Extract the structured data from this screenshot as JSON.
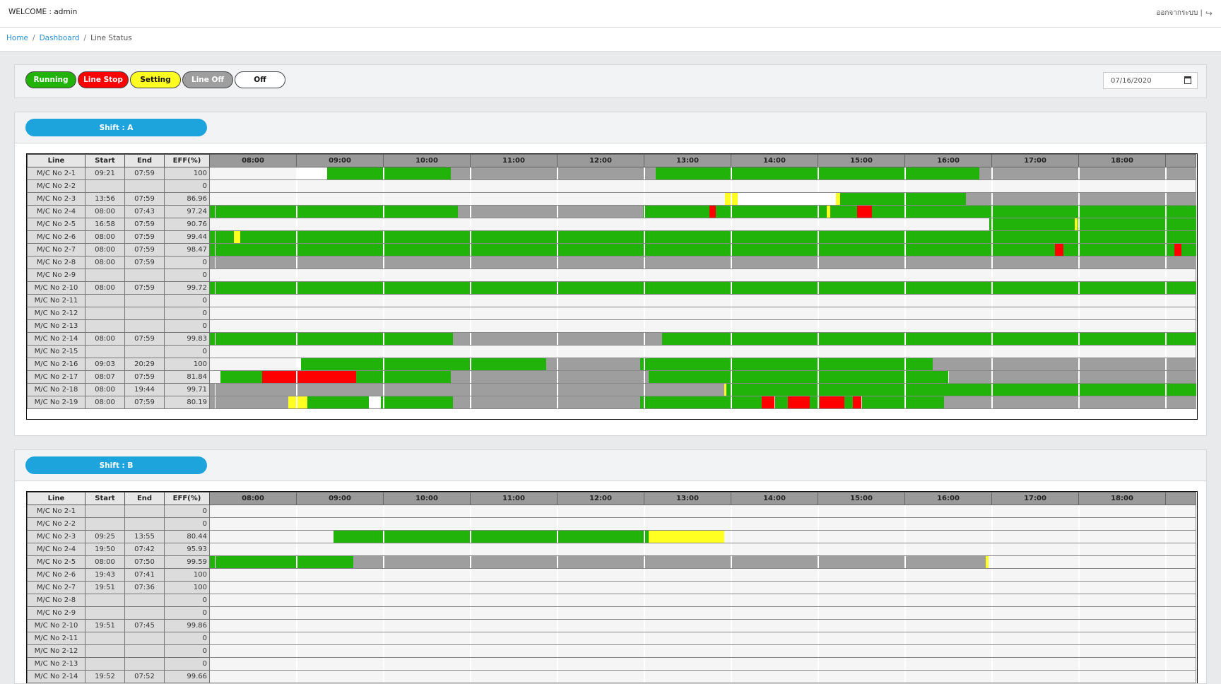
{
  "header": {
    "welcome": "WELCOME : admin",
    "logout_label": "ออกจากระบบ |",
    "logout_icon": "logout-icon"
  },
  "breadcrumb": {
    "home": "Home",
    "dashboard": "Dashboard",
    "current": "Line Status",
    "sep": "/"
  },
  "legend": [
    {
      "label": "Running",
      "color": "#22b30a",
      "text_color": "#ffffff"
    },
    {
      "label": "Line Stop",
      "color": "#ff0000",
      "text_color": "#ffffff"
    },
    {
      "label": "Setting",
      "color": "#ffff22",
      "text_color": "#111111"
    },
    {
      "label": "Line Off",
      "color": "#9e9e9e",
      "text_color": "#ffffff"
    },
    {
      "label": "Off",
      "color": "#ffffff",
      "text_color": "#111111"
    }
  ],
  "date": {
    "value": "07/16/2020",
    "icon": "calendar-icon"
  },
  "columns": {
    "line": "Line",
    "start": "Start",
    "end": "End",
    "eff": "EFF(%)"
  },
  "hours": [
    "08:00",
    "09:00",
    "10:00",
    "11:00",
    "12:00",
    "13:00",
    "14:00",
    "15:00",
    "16:00",
    "17:00",
    "18:00"
  ],
  "status_colors": {
    "R": "#22b30a",
    "S": "#ff0000",
    "T": "#ffff22",
    "G": "#9e9e9e",
    "W": "#ffffff"
  },
  "shifts": [
    {
      "name": "Shift : A",
      "rows": [
        {
          "line": "M/C No 2-1",
          "start": "09:21",
          "end": "07:59",
          "eff": "100",
          "segs": [
            [
              "W",
              1.0,
              1.35
            ],
            [
              "R",
              1.35,
              2.77
            ],
            [
              "G",
              2.77,
              5.13
            ],
            [
              "R",
              5.13,
              8.85
            ],
            [
              "G",
              8.85,
              11.35
            ]
          ]
        },
        {
          "line": "M/C No 2-2",
          "start": "",
          "end": "",
          "eff": "0",
          "segs": []
        },
        {
          "line": "M/C No 2-3",
          "start": "13:56",
          "end": "07:59",
          "eff": "86.96",
          "segs": [
            [
              "T",
              5.93,
              6.07
            ],
            [
              "W",
              6.07,
              7.2
            ],
            [
              "T",
              7.2,
              7.25
            ],
            [
              "R",
              7.25,
              8.7
            ],
            [
              "G",
              8.7,
              11.35
            ]
          ]
        },
        {
          "line": "M/C No 2-4",
          "start": "08:00",
          "end": "07:43",
          "eff": "97.24",
          "segs": [
            [
              "R",
              0,
              2.85
            ],
            [
              "G",
              2.85,
              4.98
            ],
            [
              "R",
              4.98,
              5.75
            ],
            [
              "S",
              5.75,
              5.82
            ],
            [
              "R",
              5.82,
              6.98
            ],
            [
              "T",
              6.98,
              7.0
            ],
            [
              "R",
              6.96,
              7.1
            ],
            [
              "T",
              7.1,
              7.14
            ],
            [
              "R",
              7.14,
              7.45
            ],
            [
              "S",
              7.45,
              7.62
            ],
            [
              "R",
              7.62,
              11.35
            ]
          ]
        },
        {
          "line": "M/C No 2-5",
          "start": "16:58",
          "end": "07:59",
          "eff": "90.76",
          "segs": [
            [
              "R",
              8.97,
              9.95
            ],
            [
              "T",
              9.95,
              9.98
            ],
            [
              "R",
              9.98,
              11.35
            ]
          ]
        },
        {
          "line": "M/C No 2-6",
          "start": "08:00",
          "end": "07:59",
          "eff": "99.44",
          "segs": [
            [
              "R",
              0,
              0.28
            ],
            [
              "T",
              0.28,
              0.35
            ],
            [
              "R",
              0.35,
              11.35
            ]
          ]
        },
        {
          "line": "M/C No 2-7",
          "start": "08:00",
          "end": "07:59",
          "eff": "98.47",
          "segs": [
            [
              "R",
              0,
              9.72
            ],
            [
              "S",
              9.72,
              9.82
            ],
            [
              "R",
              9.82,
              11.1
            ],
            [
              "S",
              11.1,
              11.18
            ],
            [
              "R",
              11.18,
              11.35
            ]
          ]
        },
        {
          "line": "M/C No 2-8",
          "start": "08:00",
          "end": "07:59",
          "eff": "0",
          "segs": [
            [
              "G",
              0,
              11.35
            ]
          ]
        },
        {
          "line": "M/C No 2-9",
          "start": "",
          "end": "",
          "eff": "0",
          "segs": []
        },
        {
          "line": "M/C No 2-10",
          "start": "08:00",
          "end": "07:59",
          "eff": "99.72",
          "segs": [
            [
              "R",
              0,
              11.35
            ]
          ]
        },
        {
          "line": "M/C No 2-11",
          "start": "",
          "end": "",
          "eff": "0",
          "segs": []
        },
        {
          "line": "M/C No 2-12",
          "start": "",
          "end": "",
          "eff": "0",
          "segs": []
        },
        {
          "line": "M/C No 2-13",
          "start": "",
          "end": "",
          "eff": "0",
          "segs": []
        },
        {
          "line": "M/C No 2-14",
          "start": "08:00",
          "end": "07:59",
          "eff": "99.83",
          "segs": [
            [
              "R",
              0,
              2.8
            ],
            [
              "G",
              2.8,
              5.2
            ],
            [
              "R",
              5.2,
              11.35
            ]
          ]
        },
        {
          "line": "M/C No 2-15",
          "start": "",
          "end": "",
          "eff": "0",
          "segs": []
        },
        {
          "line": "M/C No 2-16",
          "start": "09:03",
          "end": "20:29",
          "eff": "100",
          "segs": [
            [
              "W",
              1.0,
              1.05
            ],
            [
              "R",
              1.05,
              3.87
            ],
            [
              "G",
              3.87,
              4.95
            ],
            [
              "R",
              4.95,
              8.32
            ],
            [
              "G",
              8.32,
              11.35
            ]
          ]
        },
        {
          "line": "M/C No 2-17",
          "start": "08:07",
          "end": "07:59",
          "eff": "81.84",
          "segs": [
            [
              "R",
              0.12,
              0.6
            ],
            [
              "S",
              0.6,
              1.68
            ],
            [
              "R",
              1.68,
              2.77
            ],
            [
              "G",
              2.77,
              5.05
            ],
            [
              "R",
              5.05,
              8.5
            ],
            [
              "G",
              8.5,
              11.35
            ]
          ]
        },
        {
          "line": "M/C No 2-18",
          "start": "08:00",
          "end": "19:44",
          "eff": "99.71",
          "segs": [
            [
              "G",
              0,
              5.92
            ],
            [
              "T",
              5.92,
              5.94
            ],
            [
              "R",
              5.94,
              11.35
            ]
          ]
        },
        {
          "line": "M/C No 2-19",
          "start": "08:00",
          "end": "07:59",
          "eff": "80.19",
          "segs": [
            [
              "G",
              0,
              0.9
            ],
            [
              "T",
              0.9,
              1.12
            ],
            [
              "R",
              1.12,
              1.83
            ],
            [
              "W",
              1.83,
              1.97
            ],
            [
              "R",
              1.97,
              2.8
            ],
            [
              "G",
              2.8,
              4.95
            ],
            [
              "R",
              4.95,
              6.35
            ],
            [
              "S",
              6.35,
              6.5
            ],
            [
              "R",
              6.5,
              6.65
            ],
            [
              "S",
              6.65,
              6.9
            ],
            [
              "R",
              6.9,
              7.02
            ],
            [
              "S",
              7.02,
              7.3
            ],
            [
              "R",
              7.3,
              7.4
            ],
            [
              "S",
              7.4,
              7.5
            ],
            [
              "R",
              7.5,
              8.45
            ],
            [
              "G",
              8.45,
              11.35
            ]
          ]
        }
      ]
    },
    {
      "name": "Shift : B",
      "rows": [
        {
          "line": "M/C No 2-1",
          "start": "",
          "end": "",
          "eff": "0",
          "segs": []
        },
        {
          "line": "M/C No 2-2",
          "start": "",
          "end": "",
          "eff": "0",
          "segs": []
        },
        {
          "line": "M/C No 2-3",
          "start": "09:25",
          "end": "13:55",
          "eff": "80.44",
          "segs": [
            [
              "R",
              1.42,
              5.05
            ],
            [
              "T",
              5.05,
              5.92
            ]
          ]
        },
        {
          "line": "M/C No 2-4",
          "start": "19:50",
          "end": "07:42",
          "eff": "95.93",
          "segs": []
        },
        {
          "line": "M/C No 2-5",
          "start": "08:00",
          "end": "07:50",
          "eff": "99.59",
          "segs": [
            [
              "R",
              0,
              1.65
            ],
            [
              "G",
              1.65,
              8.93
            ],
            [
              "T",
              8.93,
              8.96
            ]
          ]
        },
        {
          "line": "M/C No 2-6",
          "start": "19:43",
          "end": "07:41",
          "eff": "100",
          "segs": []
        },
        {
          "line": "M/C No 2-7",
          "start": "19:51",
          "end": "07:36",
          "eff": "100",
          "segs": []
        },
        {
          "line": "M/C No 2-8",
          "start": "",
          "end": "",
          "eff": "0",
          "segs": []
        },
        {
          "line": "M/C No 2-9",
          "start": "",
          "end": "",
          "eff": "0",
          "segs": []
        },
        {
          "line": "M/C No 2-10",
          "start": "19:51",
          "end": "07:45",
          "eff": "99.86",
          "segs": []
        },
        {
          "line": "M/C No 2-11",
          "start": "",
          "end": "",
          "eff": "0",
          "segs": []
        },
        {
          "line": "M/C No 2-12",
          "start": "",
          "end": "",
          "eff": "0",
          "segs": []
        },
        {
          "line": "M/C No 2-13",
          "start": "",
          "end": "",
          "eff": "0",
          "segs": []
        },
        {
          "line": "M/C No 2-14",
          "start": "19:52",
          "end": "07:52",
          "eff": "99.66",
          "segs": []
        }
      ]
    }
  ]
}
